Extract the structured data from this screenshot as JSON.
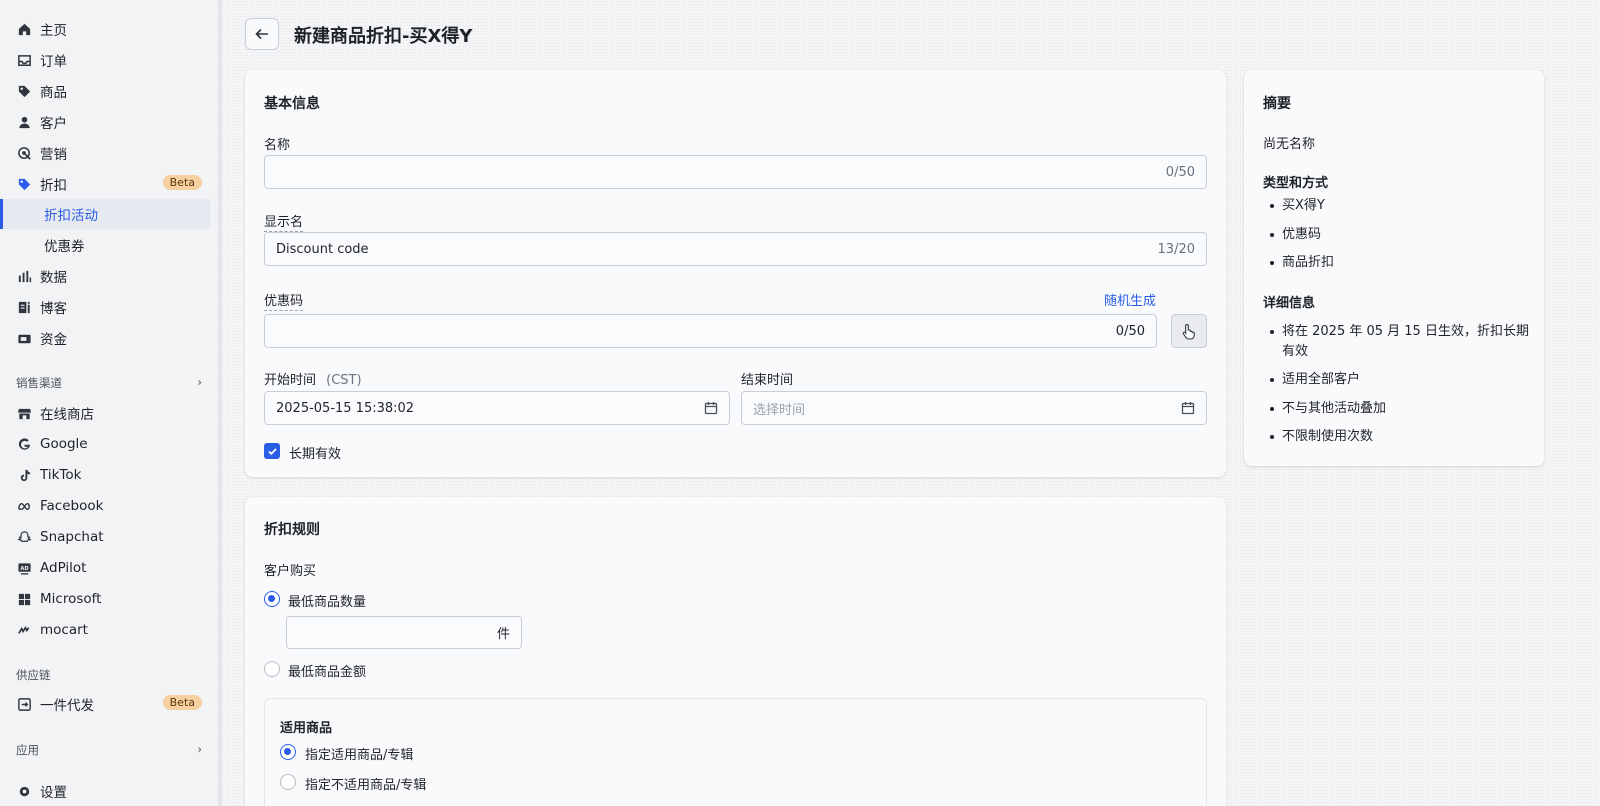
{
  "nav": {
    "home": "主页",
    "orders": "订单",
    "products": "商品",
    "customers": "客户",
    "marketing": "营销",
    "discounts": "折扣",
    "discounts_badge": "Beta",
    "discount_campaigns": "折扣活动",
    "coupons": "优惠券",
    "analytics": "数据",
    "blog": "博客",
    "finance": "资金"
  },
  "channels": {
    "title": "销售渠道",
    "items": [
      "在线商店",
      "Google",
      "TikTok",
      "Facebook",
      "Snapchat",
      "AdPilot",
      "Microsoft",
      "mocart"
    ]
  },
  "supply": {
    "title": "供应链",
    "dropship": "一件代发",
    "badge": "Beta"
  },
  "apps": {
    "title": "应用"
  },
  "settings": {
    "label": "设置"
  },
  "page": {
    "title": "新建商品折扣-买X得Y"
  },
  "basic": {
    "title": "基本信息",
    "name_label": "名称",
    "name_value": "",
    "name_counter": "0/50",
    "display_label": "显示名",
    "display_value": "Discount code",
    "display_counter": "13/20",
    "code_label": "优惠码",
    "random_link": "随机生成",
    "code_value": "",
    "code_counter": "0/50",
    "start_label": "开始时间",
    "start_tz": "(CST)",
    "start_value": "2025-05-15 15:38:02",
    "end_label": "结束时间",
    "end_placeholder": "选择时间",
    "long_term_label": "长期有效",
    "long_term_checked": true
  },
  "rules": {
    "title": "折扣规则",
    "customer_buys": "客户购买",
    "min_qty": "最低商品数量",
    "qty_unit": "件",
    "min_amount": "最低商品金额",
    "applies_title": "适用商品",
    "specify_include": "指定适用商品/专辑",
    "specify_exclude": "指定不适用商品/专辑"
  },
  "summary": {
    "title": "摘要",
    "no_name": "尚无名称",
    "type_title": "类型和方式",
    "type_items": [
      "买X得Y",
      "优惠码",
      "商品折扣"
    ],
    "detail_title": "详细信息",
    "detail_items": [
      "将在 2025 年 05 月 15 日生效，折扣长期有效",
      "适用全部客户",
      "不与其他活动叠加",
      "不限制使用次数"
    ]
  },
  "colors": {
    "accent": "#2b5ce6",
    "badge": "#f8cf9f"
  }
}
